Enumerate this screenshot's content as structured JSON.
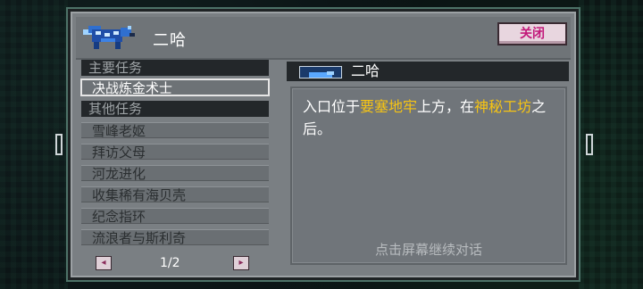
{
  "dialog": {
    "title": "二哈",
    "close_label": "关闭",
    "portrait_icon": "blue-wolf-portrait-icon",
    "colors": {
      "panel": "#7a7f83",
      "header": "#23272a",
      "highlight": "#f6c414",
      "close_text": "#c2187a"
    }
  },
  "quests": {
    "main_header": "主要任务",
    "main_items": [
      "决战炼金术士"
    ],
    "selected_index": 0,
    "other_header": "其他任务",
    "other_items": [
      "雪峰老妪",
      "拜访父母",
      "河龙进化",
      "收集稀有海贝壳",
      "纪念指环",
      "流浪者与斯利奇"
    ]
  },
  "pager": {
    "prev_icon": "left-arrow-icon",
    "next_icon": "right-arrow-icon",
    "page_label": "1/2"
  },
  "detail": {
    "speaker": "二哈",
    "text_parts": {
      "p1": "入口位于",
      "h1": "要塞地牢",
      "p2": "上方，在",
      "h2": "神秘工坊",
      "p3": "之后。"
    },
    "continue_hint": "点击屏幕继续对话"
  }
}
